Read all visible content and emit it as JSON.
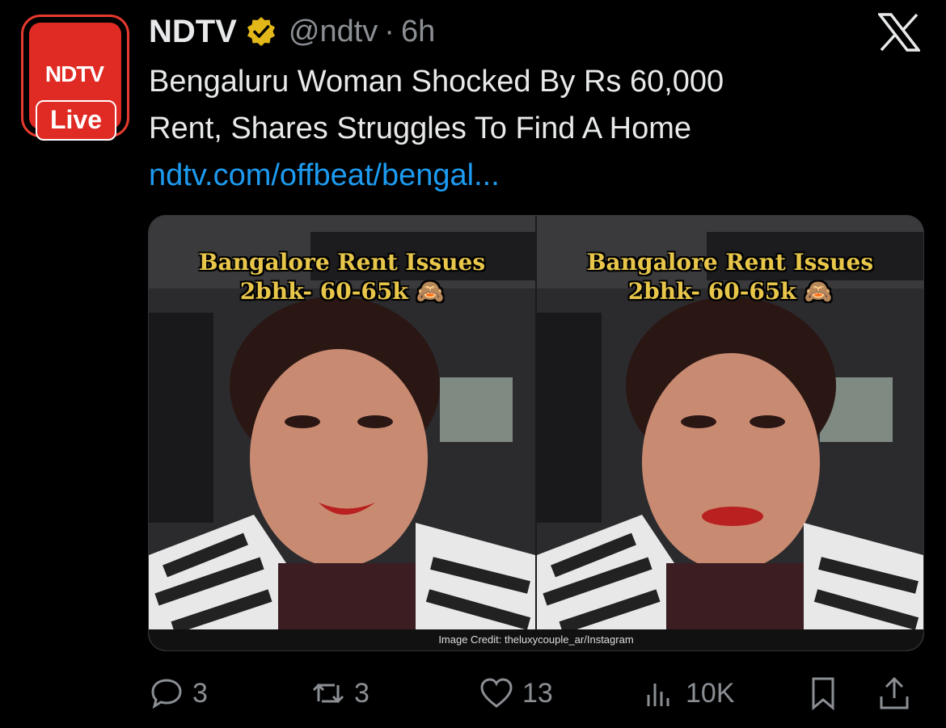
{
  "author": {
    "avatar_logo": "NDTV",
    "avatar_live": "Live",
    "name": "NDTV",
    "handle": "@ndtv",
    "separator": "·",
    "time": "6h",
    "verified_icon": "gold-check-badge-icon"
  },
  "tweet": {
    "text_line1": "Bengaluru Woman Shocked By Rs 60,000",
    "text_line2": "Rent, Shares Struggles To Find A Home",
    "link": "ndtv.com/offbeat/bengal..."
  },
  "media": {
    "panel_left": {
      "caption_line1": "Bangalore Rent Issues",
      "caption_line2": "2bhk- 60-65k 🙈"
    },
    "panel_right": {
      "caption_line1": "Bangalore Rent Issues",
      "caption_line2": "2bhk- 60-65k 🙈"
    },
    "credit": "Image Credit: theluxycouple_ar/Instagram"
  },
  "actions": {
    "replies": "3",
    "reposts": "3",
    "likes": "13",
    "views": "10K"
  },
  "colors": {
    "background": "#000000",
    "text": "#e7e9ea",
    "muted": "#8b8f94",
    "link": "#1d9bf0",
    "ndtv_red": "#e02a24",
    "verified_gold": "#e2b719"
  }
}
